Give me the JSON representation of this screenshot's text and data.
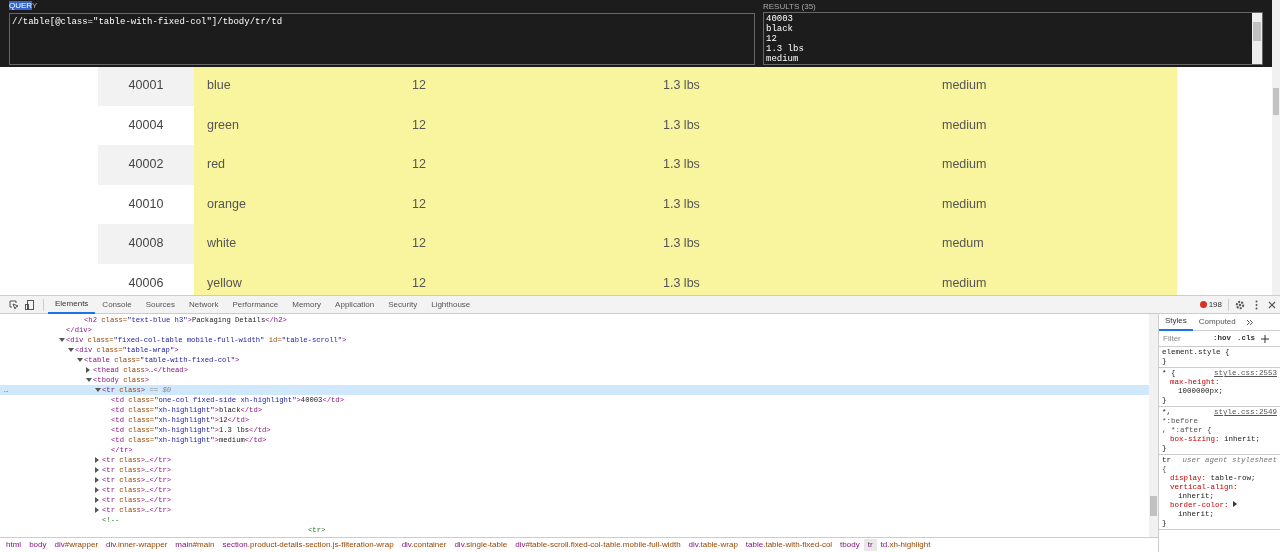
{
  "xpath_helper": {
    "query_label": [
      {
        "text": "QUER",
        "selected": true
      },
      {
        "text": "Y",
        "selected": false
      }
    ],
    "query": "//table[@class=\"table-with-fixed-col\"]/tbody/tr/td",
    "results_label": "RESULTS (35)",
    "results": [
      "40003",
      "black",
      "12",
      "1.3 lbs",
      "medium"
    ]
  },
  "product_table": {
    "rows": [
      {
        "cells": [
          "40001",
          "blue",
          "12",
          "1.3 lbs",
          "medium"
        ],
        "highlighted": true
      },
      {
        "cells": [
          "40004",
          "green",
          "12",
          "1.3 lbs",
          "medium"
        ],
        "highlighted": true
      },
      {
        "cells": [
          "40002",
          "red",
          "12",
          "1.3 lbs",
          "medium"
        ],
        "highlighted": true
      },
      {
        "cells": [
          "40010",
          "orange",
          "12",
          "1.3 lbs",
          "medium"
        ],
        "highlighted": true
      },
      {
        "cells": [
          "40008",
          "white",
          "12",
          "1.3 lbs",
          "medum"
        ],
        "highlighted": true
      },
      {
        "cells": [
          "40006",
          "yellow",
          "12",
          "1.3 lbs",
          "medium"
        ],
        "highlighted": true
      }
    ]
  },
  "devtools": {
    "tabs": [
      {
        "label": "Elements",
        "selected": true
      },
      {
        "label": "Console",
        "selected": false
      },
      {
        "label": "Sources",
        "selected": false
      },
      {
        "label": "Network",
        "selected": false
      },
      {
        "label": "Performance",
        "selected": false
      },
      {
        "label": "Memory",
        "selected": false
      },
      {
        "label": "Application",
        "selected": false
      },
      {
        "label": "Security",
        "selected": false
      },
      {
        "label": "Lighthouse",
        "selected": false
      }
    ],
    "error_count": "198",
    "dom_tree": [
      {
        "children": [
          {
            "text": "<h2 class=\"text-blue h3\">Packaging Details</h2>",
            "kind": "markup",
            "selected": false
          }
        ]
      },
      {
        "text": "</div>",
        "kind": "markup",
        "selected": false
      },
      {
        "text": "<div class=\"fixed-col-table mobile-full-width\" id=\"table-scroll\">",
        "kind": "markup",
        "selected": false,
        "expanded": true,
        "children": [
          {
            "text": "<div class=\"table-wrap\">",
            "kind": "markup",
            "selected": false,
            "expanded": true,
            "children": [
              {
                "text": "<table class=\"table-with-fixed-col\">",
                "kind": "markup",
                "selected": false,
                "expanded": true,
                "children": [
                  {
                    "text": "<thead class>…</thead>",
                    "kind": "markup",
                    "selected": false,
                    "expanded": false
                  },
                  {
                    "text": "<tbody class>",
                    "kind": "markup",
                    "selected": false,
                    "expanded": true,
                    "children": [
                      {
                        "text": "<tr class>",
                        "suffix": "== $0",
                        "gutter_mark": "…",
                        "kind": "markup",
                        "selected": true,
                        "expanded": true,
                        "children": [
                          {
                            "text": "<td class=\"one-col fixed-side xh-highlight\">40003</td>",
                            "kind": "markup",
                            "selected": false
                          },
                          {
                            "text": "<td class=\"xh-highlight\">black</td>",
                            "kind": "markup",
                            "selected": false
                          },
                          {
                            "text": "<td class=\"xh-highlight\">12</td>",
                            "kind": "markup",
                            "selected": false
                          },
                          {
                            "text": "<td class=\"xh-highlight\">1.3 lbs</td>",
                            "kind": "markup",
                            "selected": false
                          },
                          {
                            "text": "<td class=\"xh-highlight\">medium</td>",
                            "kind": "markup",
                            "selected": false
                          },
                          {
                            "text": "</tr>",
                            "kind": "markup",
                            "selected": false
                          }
                        ]
                      },
                      {
                        "text": "<tr class>…</tr>",
                        "kind": "markup",
                        "selected": false,
                        "expanded": false
                      },
                      {
                        "text": "<tr class>…</tr>",
                        "kind": "markup",
                        "selected": false,
                        "expanded": false
                      },
                      {
                        "text": "<tr class>…</tr>",
                        "kind": "markup",
                        "selected": false,
                        "expanded": false
                      },
                      {
                        "text": "<tr class>…</tr>",
                        "kind": "markup",
                        "selected": false,
                        "expanded": false
                      },
                      {
                        "text": "<tr class>…</tr>",
                        "kind": "markup",
                        "selected": false,
                        "expanded": false
                      },
                      {
                        "text": "<tr class>…</tr>",
                        "kind": "markup",
                        "selected": false,
                        "expanded": false
                      },
                      {
                        "text": "<!--",
                        "kind": "comment",
                        "selected": false
                      },
                      {
                        "text": "<tr>",
                        "kind": "comment-body",
                        "selected": false
                      }
                    ]
                  }
                ]
              }
            ]
          }
        ]
      }
    ],
    "styles_tabs": [
      {
        "label": "Styles",
        "selected": true
      },
      {
        "label": "Computed",
        "selected": false
      }
    ],
    "filter_placeholder": "Filter",
    "filter_buttons": [
      ":hov",
      ".cls"
    ],
    "rules": [
      {
        "selector": "element.style {",
        "close": "}"
      },
      {
        "selector": "* {",
        "source": "style.css:2553",
        "declarations": [
          {
            "property": "max-height:",
            "value": "1000000px;",
            "inline": false
          }
        ],
        "close": "}"
      },
      {
        "selector": "*,",
        "selector_more": [
          "*:before",
          ", *:after {"
        ],
        "source": "style.css:2549",
        "declarations": [
          {
            "property": "box-sizing:",
            "value": "inherit;",
            "inline": true
          }
        ],
        "close": "}"
      },
      {
        "selector": "tr",
        "origin": "user agent stylesheet",
        "selector_more": [
          "{"
        ],
        "declarations": [
          {
            "property": "display:",
            "value": "table-row;",
            "inline": true
          },
          {
            "property": "vertical-align:",
            "value": "inherit;",
            "inline": false
          },
          {
            "property": "border-color:",
            "value": "inherit;",
            "inline": false,
            "expandable": true
          }
        ],
        "close": "}"
      }
    ],
    "breadcrumbs": [
      {
        "text": "html",
        "selected": false
      },
      {
        "text": "body",
        "selected": false
      },
      {
        "text": "div#wrapper",
        "selected": false
      },
      {
        "text": "div.inner-wrapper",
        "selected": false
      },
      {
        "text": "main#main",
        "selected": false
      },
      {
        "text": "section.product-details-section.js-filteration-wrap",
        "selected": false
      },
      {
        "text": "div.container",
        "selected": false
      },
      {
        "text": "div.single-table",
        "selected": false
      },
      {
        "text": "div#table-scroll.fixed-col-table.mobile-full-width",
        "selected": false
      },
      {
        "text": "div.table-wrap",
        "selected": false
      },
      {
        "text": "table.table-with-fixed-col",
        "selected": false
      },
      {
        "text": "tbody",
        "selected": false
      },
      {
        "text": "tr",
        "selected": true
      },
      {
        "text": "td.xh-highlight",
        "selected": false
      }
    ]
  }
}
